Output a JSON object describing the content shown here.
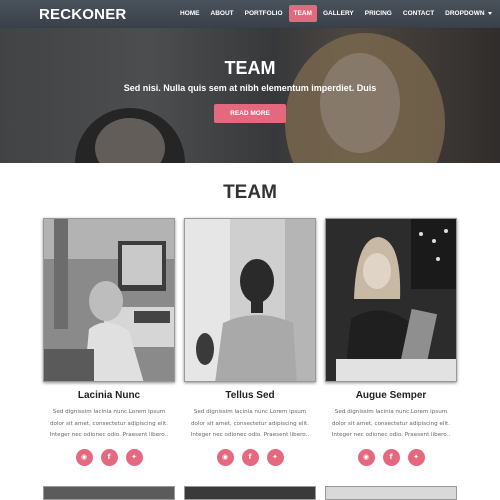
{
  "brand": {
    "name": "RECKONER"
  },
  "nav": {
    "items": [
      {
        "label": "HOME"
      },
      {
        "label": "ABOUT"
      },
      {
        "label": "PORTFOLIO"
      },
      {
        "label": "TEAM"
      },
      {
        "label": "GALLERY"
      },
      {
        "label": "PRICING"
      },
      {
        "label": "CONTACT"
      },
      {
        "label": "DROPDOWN"
      }
    ],
    "active": "TEAM"
  },
  "hero": {
    "title": "TEAM",
    "subtitle": "Sed nisi. Nulla quis sem at nibh elementum imperdiet. Duis",
    "button_label": "READ MORE"
  },
  "section": {
    "title": "TEAM"
  },
  "members": [
    {
      "name": "Lacinia Nunc",
      "desc": "Sed dignissim lacinia nunc.Lorem ipsum dolor sit amet, consectetur adipiscing elit. Integer nec odionec odio. Praesent libero..",
      "socials": [
        "rss-icon",
        "facebook-icon",
        "twitter-icon"
      ]
    },
    {
      "name": "Tellus Sed",
      "desc": "Sed dignissim lacinia nunc.Lorem ipsum dolor sit amet, consectetur adipiscing elit. Integer nec odionec odio. Praesent libero..",
      "socials": [
        "rss-icon",
        "facebook-icon",
        "twitter-icon"
      ]
    },
    {
      "name": "Augue Semper",
      "desc": "Sed dignissim lacinia nunc.Lorem ipsum dolor sit amet, consectetur adipiscing elit. Integer nec odionec odio. Praesent libero..",
      "socials": [
        "rss-icon",
        "facebook-icon",
        "twitter-icon"
      ]
    }
  ],
  "colors": {
    "accent": "#e4697f",
    "navbar": "#3f454e"
  }
}
